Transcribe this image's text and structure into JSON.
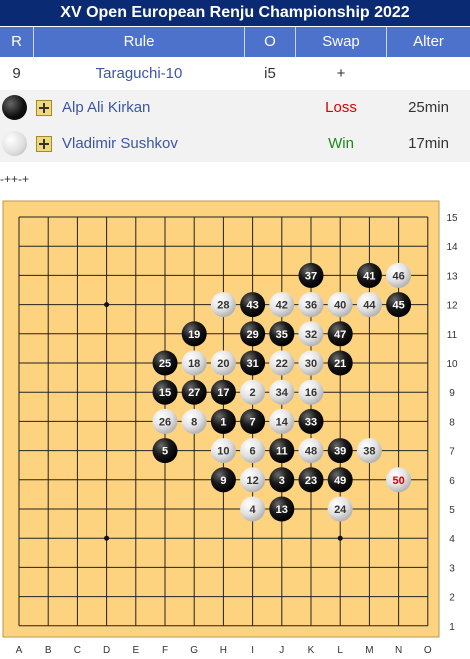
{
  "title": "XV Open European Renju Championship 2022",
  "table": {
    "headers": {
      "r": "R",
      "rule": "Rule",
      "o": "O",
      "swap": "Swap",
      "alter": "Alter"
    },
    "row": {
      "r": "9",
      "rule": "Taraguchi-10",
      "o": "i5",
      "swap": "+",
      "alter": ""
    }
  },
  "players": [
    {
      "name": "Alp Ali Kirkan",
      "stone": "black",
      "result": "Loss",
      "time": "25min"
    },
    {
      "name": "Vladimir Sushkov",
      "stone": "white",
      "result": "Win",
      "time": "17min"
    }
  ],
  "misc_text": "-++-+",
  "board": {
    "size": 15,
    "columns": [
      "A",
      "B",
      "C",
      "D",
      "E",
      "F",
      "G",
      "H",
      "I",
      "J",
      "K",
      "L",
      "M",
      "N",
      "O"
    ],
    "rows": [
      "15",
      "14",
      "13",
      "12",
      "11",
      "10",
      "9",
      "8",
      "7",
      "6",
      "5",
      "4",
      "3",
      "2",
      "1"
    ],
    "star_points": [
      "D12",
      "L12",
      "H8",
      "D4",
      "L4"
    ],
    "last_move_color": "#dd0000",
    "moves": [
      {
        "n": 1,
        "pos": "H8"
      },
      {
        "n": 2,
        "pos": "I9"
      },
      {
        "n": 3,
        "pos": "J6"
      },
      {
        "n": 4,
        "pos": "I5"
      },
      {
        "n": 5,
        "pos": "F7"
      },
      {
        "n": 6,
        "pos": "I7"
      },
      {
        "n": 7,
        "pos": "I8"
      },
      {
        "n": 8,
        "pos": "G8"
      },
      {
        "n": 9,
        "pos": "H6"
      },
      {
        "n": 10,
        "pos": "H7"
      },
      {
        "n": 11,
        "pos": "J7"
      },
      {
        "n": 12,
        "pos": "I6"
      },
      {
        "n": 13,
        "pos": "J5"
      },
      {
        "n": 14,
        "pos": "J8"
      },
      {
        "n": 15,
        "pos": "F9"
      },
      {
        "n": 16,
        "pos": "K9"
      },
      {
        "n": 17,
        "pos": "H9"
      },
      {
        "n": 18,
        "pos": "G10"
      },
      {
        "n": 19,
        "pos": "G11"
      },
      {
        "n": 20,
        "pos": "H10"
      },
      {
        "n": 21,
        "pos": "L10"
      },
      {
        "n": 22,
        "pos": "J10"
      },
      {
        "n": 23,
        "pos": "K6"
      },
      {
        "n": 24,
        "pos": "L5"
      },
      {
        "n": 25,
        "pos": "F10"
      },
      {
        "n": 26,
        "pos": "F8"
      },
      {
        "n": 27,
        "pos": "G9"
      },
      {
        "n": 28,
        "pos": "H12"
      },
      {
        "n": 29,
        "pos": "I11"
      },
      {
        "n": 30,
        "pos": "K10"
      },
      {
        "n": 31,
        "pos": "I10"
      },
      {
        "n": 32,
        "pos": "K11"
      },
      {
        "n": 33,
        "pos": "K8"
      },
      {
        "n": 34,
        "pos": "J9"
      },
      {
        "n": 35,
        "pos": "J11"
      },
      {
        "n": 36,
        "pos": "K12"
      },
      {
        "n": 37,
        "pos": "K13"
      },
      {
        "n": 38,
        "pos": "M7"
      },
      {
        "n": 39,
        "pos": "L7"
      },
      {
        "n": 40,
        "pos": "L12"
      },
      {
        "n": 41,
        "pos": "M13"
      },
      {
        "n": 42,
        "pos": "J12"
      },
      {
        "n": 43,
        "pos": "I12"
      },
      {
        "n": 44,
        "pos": "M12"
      },
      {
        "n": 45,
        "pos": "N12"
      },
      {
        "n": 46,
        "pos": "N13"
      },
      {
        "n": 47,
        "pos": "L11"
      },
      {
        "n": 48,
        "pos": "K7"
      },
      {
        "n": 49,
        "pos": "L6"
      },
      {
        "n": 50,
        "pos": "N6"
      }
    ]
  }
}
